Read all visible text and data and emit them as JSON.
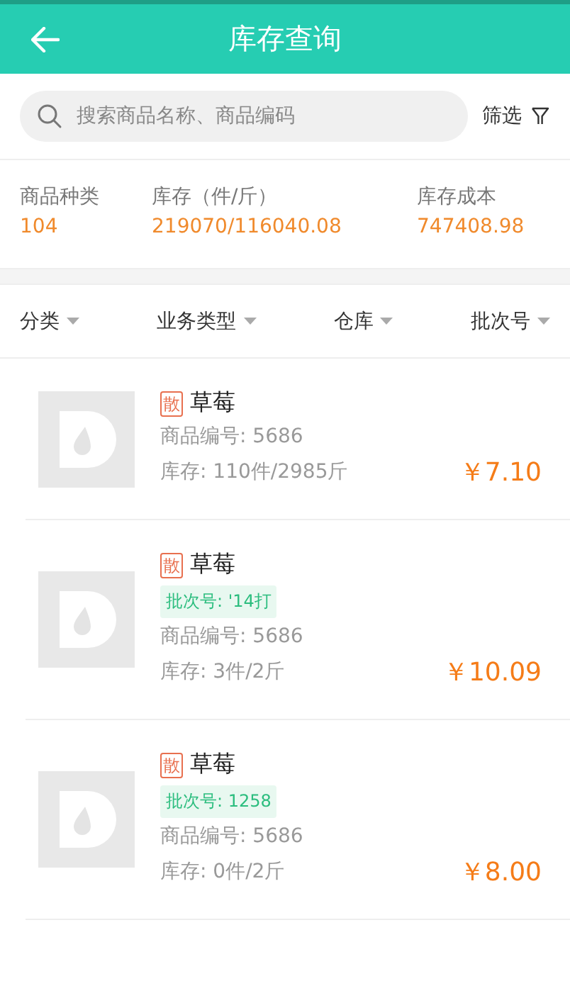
{
  "header": {
    "title": "库存查询"
  },
  "search": {
    "placeholder": "搜索商品名称、商品编码",
    "filter_label": "筛选"
  },
  "stats": [
    {
      "label": "商品种类",
      "value": "104"
    },
    {
      "label": "库存（件/斤）",
      "value": "219070/116040.08"
    },
    {
      "label": "库存成本",
      "value": "747408.98"
    }
  ],
  "filters": [
    {
      "label": "分类"
    },
    {
      "label": "业务类型"
    },
    {
      "label": "仓库"
    },
    {
      "label": "批次号"
    }
  ],
  "items": [
    {
      "tag": "散",
      "name": "草莓",
      "code": "商品编号: 5686",
      "stock": "库存: 110件/2985斤",
      "price": "￥7.10"
    },
    {
      "tag": "散",
      "name": "草莓",
      "batch": "批次号: '14打",
      "code": "商品编号: 5686",
      "stock": "库存: 3件/2斤",
      "price": "￥10.09"
    },
    {
      "tag": "散",
      "name": "草莓",
      "batch": "批次号: 1258",
      "code": "商品编号: 5686",
      "stock": "库存: 0件/2斤",
      "price": "￥8.00"
    }
  ]
}
